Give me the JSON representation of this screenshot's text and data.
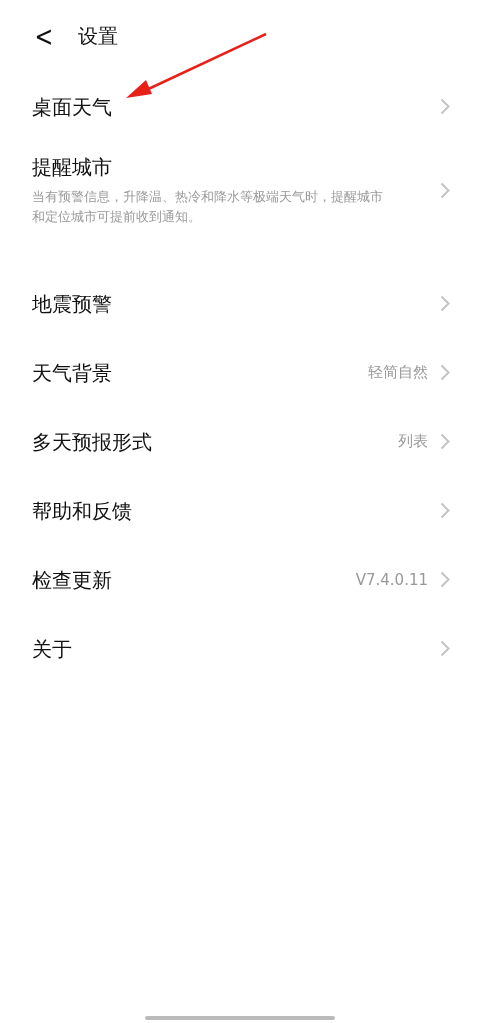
{
  "header": {
    "back": "<",
    "title": "设置"
  },
  "sections": [
    [
      {
        "title": "桌面天气"
      },
      {
        "title": "提醒城市",
        "description": "当有预警信息，升降温、热冷和降水等极端天气时，提醒城市和定位城市可提前收到通知。"
      }
    ],
    [
      {
        "title": "地震预警"
      },
      {
        "title": "天气背景",
        "value": "轻简自然"
      },
      {
        "title": "多天预报形式",
        "value": "列表"
      },
      {
        "title": "帮助和反馈"
      },
      {
        "title": "检查更新",
        "value": "V7.4.0.11"
      },
      {
        "title": "关于"
      }
    ]
  ]
}
